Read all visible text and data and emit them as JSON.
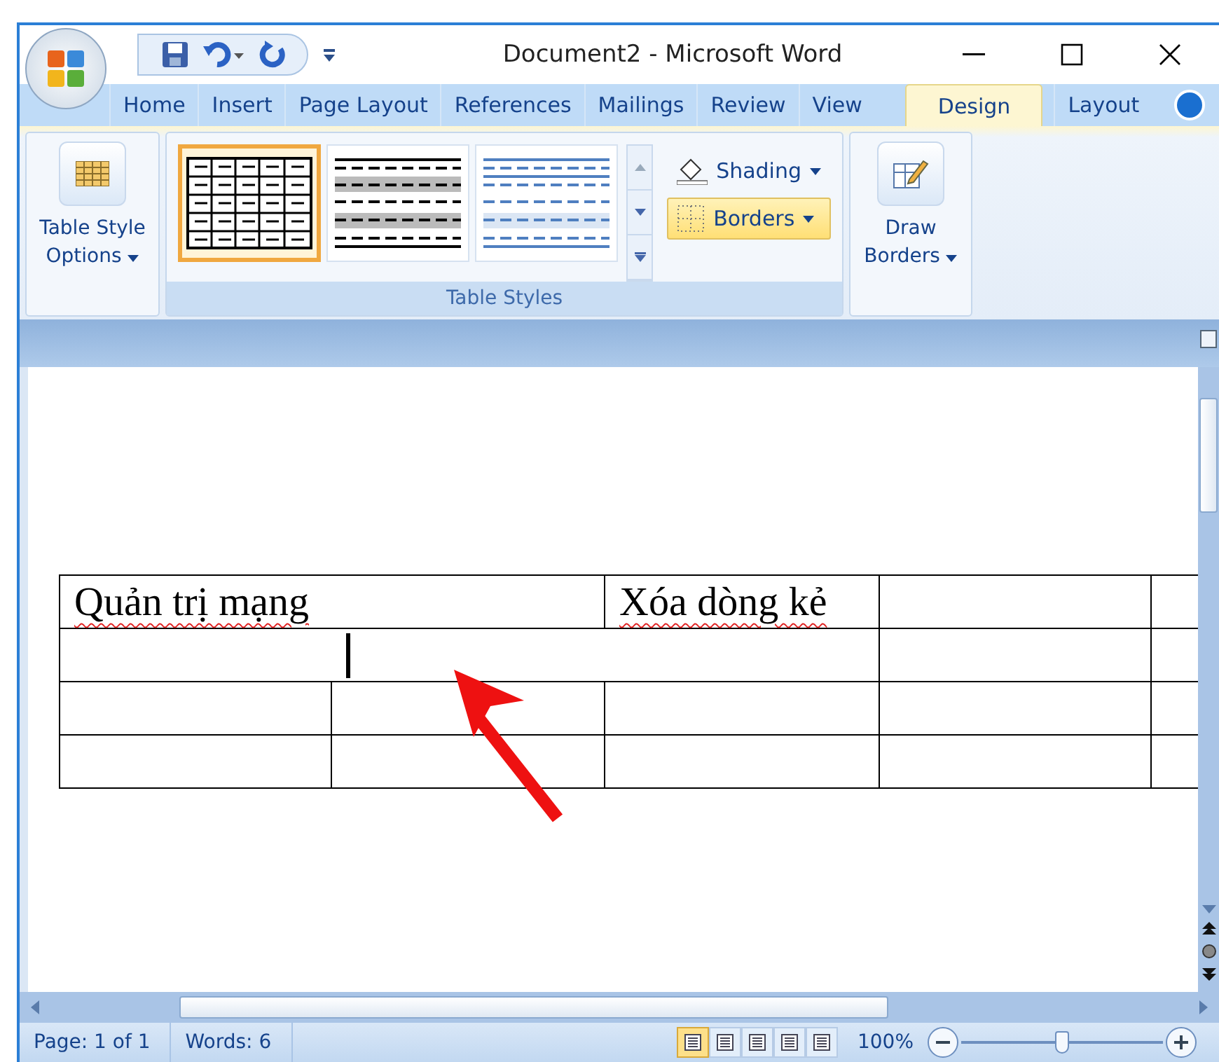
{
  "window": {
    "title": "Document2 - Microsoft Word"
  },
  "tabs": [
    {
      "label": "Home",
      "selected": false
    },
    {
      "label": "Insert",
      "selected": false
    },
    {
      "label": "Page Layout",
      "selected": false
    },
    {
      "label": "References",
      "selected": false
    },
    {
      "label": "Mailings",
      "selected": false
    },
    {
      "label": "Review",
      "selected": false
    },
    {
      "label": "View",
      "selected": false
    },
    {
      "label": "Design",
      "selected": true
    },
    {
      "label": "Layout",
      "selected": false
    }
  ],
  "ribbon": {
    "table_style_options": "Table Style Options",
    "styles": [
      {
        "kind": "grid",
        "selected": true
      },
      {
        "kind": "banded",
        "selected": false
      },
      {
        "kind": "light",
        "selected": false
      }
    ],
    "shading": "Shading",
    "borders": {
      "label": "Borders",
      "highlighted": true
    },
    "group_label": "Table Styles",
    "draw_borders": "Draw Borders"
  },
  "table": {
    "rows": [
      {
        "kind": "header",
        "cells": [
          {
            "text": "Quản trị mạng",
            "misspelled": true,
            "cursor": false
          },
          {
            "text": "Xóa dòng kẻ",
            "misspelled": true,
            "cursor": false
          },
          {
            "cursor": false
          },
          {
            "cursor": false
          }
        ]
      },
      {
        "kind": "merged",
        "cells": [
          {
            "cursor": true
          },
          {
            "cursor": false
          },
          {
            "cursor": false
          }
        ]
      },
      {
        "kind": "plain",
        "cells": [
          {
            "cursor": false
          },
          {
            "cursor": false
          },
          {
            "cursor": false
          },
          {
            "cursor": false
          },
          {
            "cursor": false
          }
        ]
      },
      {
        "kind": "plain",
        "cells": [
          {
            "cursor": false
          },
          {
            "cursor": false
          },
          {
            "cursor": false
          },
          {
            "cursor": false
          },
          {
            "cursor": false
          }
        ]
      }
    ]
  },
  "status_bar": {
    "page": "Page: 1 of 1",
    "words": "Words: 6",
    "views": [
      {
        "selected": true
      },
      {
        "selected": false
      },
      {
        "selected": false
      },
      {
        "selected": false
      },
      {
        "selected": false
      }
    ],
    "zoom": "100%",
    "zoom_slider": {
      "level": 0.5
    }
  }
}
